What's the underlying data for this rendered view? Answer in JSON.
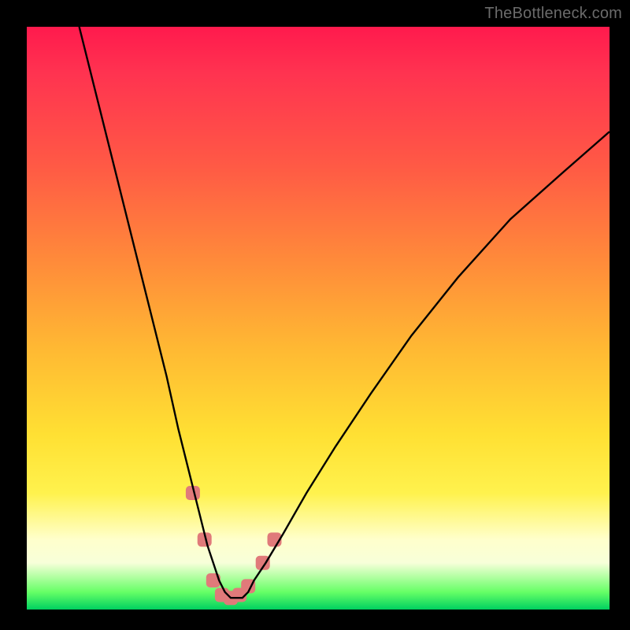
{
  "watermark": "TheBottleneck.com",
  "chart_data": {
    "type": "line",
    "title": "",
    "xlabel": "",
    "ylabel": "",
    "xlim": [
      0,
      100
    ],
    "ylim": [
      0,
      100
    ],
    "grid": false,
    "annotations": [],
    "series": [
      {
        "name": "bottleneck-curve",
        "color": "#000000",
        "x": [
          9,
          12,
          15,
          18,
          21,
          24,
          26,
          28,
          30,
          31,
          32,
          33,
          34,
          35,
          36,
          37,
          38,
          39,
          41,
          44,
          48,
          53,
          59,
          66,
          74,
          83,
          92,
          100
        ],
        "y": [
          100,
          88,
          76,
          64,
          52,
          40,
          31,
          23,
          15,
          11,
          8,
          5,
          3,
          2,
          2,
          2,
          3,
          5,
          8,
          13,
          20,
          28,
          37,
          47,
          57,
          67,
          75,
          82
        ]
      }
    ],
    "markers": [
      {
        "name": "highlight-points",
        "color": "#e07a7a",
        "shape": "rounded-square",
        "points": [
          {
            "x": 28.5,
            "y": 20
          },
          {
            "x": 30.5,
            "y": 12
          },
          {
            "x": 32.0,
            "y": 5
          },
          {
            "x": 33.5,
            "y": 2.5
          },
          {
            "x": 35.0,
            "y": 2
          },
          {
            "x": 36.5,
            "y": 2.5
          },
          {
            "x": 38.0,
            "y": 4
          },
          {
            "x": 40.5,
            "y": 8
          },
          {
            "x": 42.5,
            "y": 12
          }
        ]
      }
    ],
    "background_gradient": {
      "top": "#ff1a4d",
      "upper_mid": "#ff8a3a",
      "mid": "#ffe033",
      "lower_mid": "#ffffcc",
      "bottom": "#00d060"
    }
  }
}
